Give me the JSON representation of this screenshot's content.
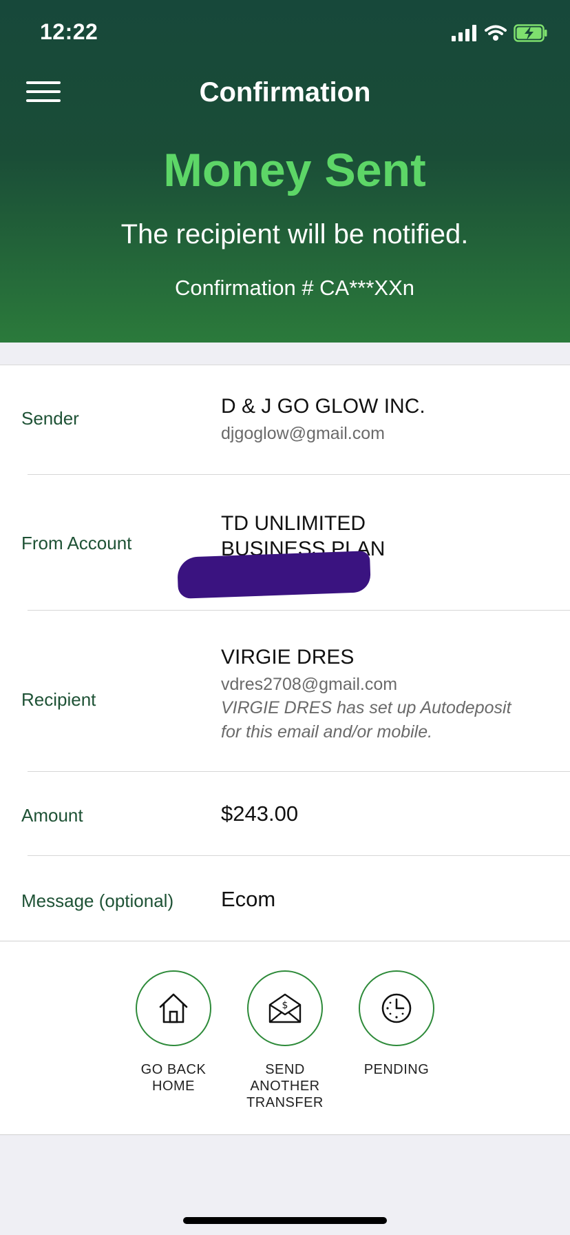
{
  "status_bar": {
    "time": "12:22"
  },
  "header": {
    "title": "Confirmation",
    "headline": "Money Sent",
    "subtitle": "The recipient will be notified.",
    "confirmation": "Confirmation # CA***XXn"
  },
  "details": {
    "sender": {
      "label": "Sender",
      "name": "D & J GO GLOW INC.",
      "email": "djgoglow@gmail.com"
    },
    "from_account": {
      "label": "From Account",
      "line1": "TD UNLIMITED",
      "line2": "BUSINESS PLAN"
    },
    "recipient": {
      "label": "Recipient",
      "name": "VIRGIE DRES",
      "email": "vdres2708@gmail.com",
      "note_line1": "VIRGIE DRES has set up Autodeposit",
      "note_line2": "for this email and/or mobile."
    },
    "amount": {
      "label": "Amount",
      "value": "$243.00"
    },
    "message": {
      "label": "Message (optional)",
      "value": "Ecom"
    }
  },
  "actions": [
    {
      "label": "GO BACK\nHOME",
      "icon": "home-icon"
    },
    {
      "label": "SEND\nANOTHER\nTRANSFER",
      "icon": "money-envelope-icon"
    },
    {
      "label": "PENDING",
      "icon": "clock-icon"
    }
  ],
  "colors": {
    "header_dark": "#17483a",
    "header_light": "#2b7a3b",
    "headline_green": "#5dd667",
    "label_green": "#1e5235",
    "action_circle": "#2d8a39"
  }
}
